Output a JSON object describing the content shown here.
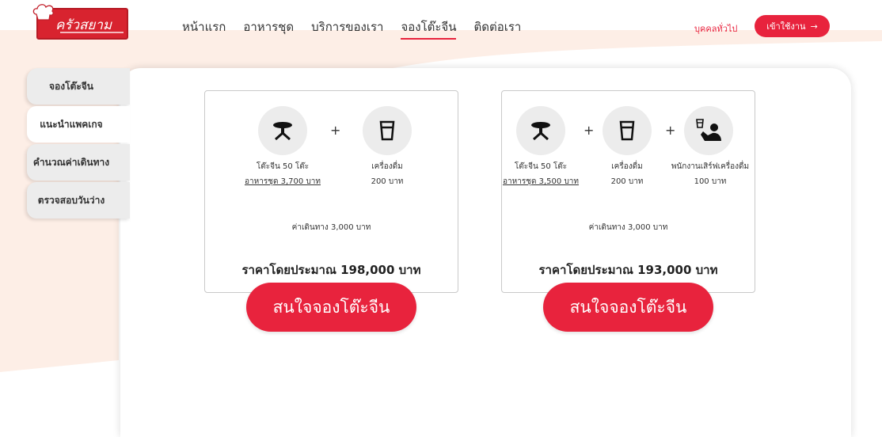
{
  "logo": {
    "text": "ครัวสยาม"
  },
  "nav": {
    "items": [
      "หน้าแรก",
      "อาหารชุด",
      "บริการของเรา",
      "จองโต๊ะจีน",
      "ติดต่อเรา"
    ],
    "active_index": 3
  },
  "header": {
    "visitor_label": "บุคคลทั่วไป",
    "login_label": "เข้าใช้งาน",
    "login_arrow": "→"
  },
  "sidebar": {
    "items": [
      {
        "label": "จองโต๊ะจีน"
      },
      {
        "label": "แนะนำแพคเกจ"
      },
      {
        "label": "คำนวณค่าเดินทาง"
      },
      {
        "label": "ตรวจสอบวันว่าง"
      }
    ],
    "active_index": 1
  },
  "packages": [
    {
      "items": [
        {
          "icon": "table-icon",
          "label": "โต๊ะจีน 50 โต๊ะ",
          "sub": "อาหารชุด 3,700 บาท"
        },
        {
          "icon": "glass-icon",
          "label": "เครื่องดื่ม",
          "sub": "200 บาท"
        }
      ],
      "travel": "ค่าเดินทาง 3,000 บาท",
      "total": "ราคาโดยประมาณ 198,000 บาท",
      "cta": "สนใจจองโต๊ะจีน"
    },
    {
      "items": [
        {
          "icon": "table-icon",
          "label": "โต๊ะจีน 50 โต๊ะ",
          "sub": "อาหารชุด 3,500 บาท"
        },
        {
          "icon": "glass-icon",
          "label": "เครื่องดื่ม",
          "sub": "200 บาท"
        },
        {
          "icon": "waiter-icon",
          "label": "พนักงานเสิร์ฟเครื่องดื่ม",
          "sub": "100 บาท"
        }
      ],
      "travel": "ค่าเดินทาง 3,000 บาท",
      "total": "ราคาโดยประมาณ 193,000 บาท",
      "cta": "สนใจจองโต๊ะจีน"
    }
  ],
  "colors": {
    "accent": "#e8233d",
    "background_wave": "#fdeee6",
    "icon_circle": "#ececec"
  }
}
